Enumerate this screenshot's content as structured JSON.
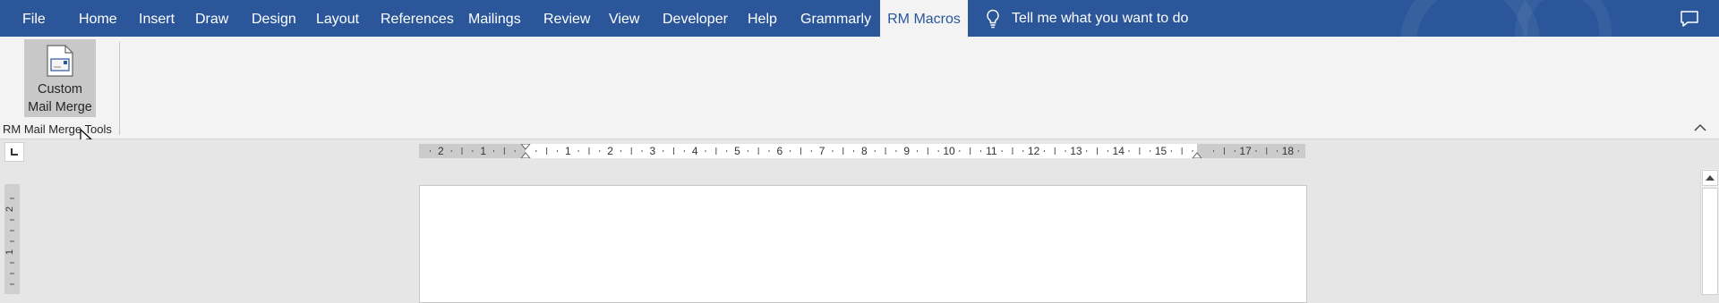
{
  "tabs": [
    {
      "label": "File"
    },
    {
      "label": "Home"
    },
    {
      "label": "Insert"
    },
    {
      "label": "Draw"
    },
    {
      "label": "Design"
    },
    {
      "label": "Layout"
    },
    {
      "label": "References"
    },
    {
      "label": "Mailings"
    },
    {
      "label": "Review"
    },
    {
      "label": "View"
    },
    {
      "label": "Developer"
    },
    {
      "label": "Help"
    },
    {
      "label": "Grammarly"
    },
    {
      "label": "RM Macros",
      "active": true
    }
  ],
  "tell_me": {
    "text": "Tell me what you want to do",
    "icon": "lightbulb-icon"
  },
  "ribbon": {
    "button": {
      "line1": "Custom",
      "line2": "Mail Merge",
      "icon": "document-icon"
    },
    "group_label": "RM Mail Merge Tools"
  },
  "horizontal_ruler": {
    "left_numbers": [
      "2",
      "1"
    ],
    "right_numbers": [
      "1",
      "2",
      "3",
      "4",
      "5",
      "6",
      "7",
      "8",
      "9",
      "10",
      "11",
      "12",
      "13",
      "14",
      "15",
      "17",
      "18"
    ]
  },
  "vertical_ruler": {
    "numbers": [
      "2",
      "1"
    ]
  },
  "colors": {
    "accent": "#2b579a",
    "ribbon_bg": "#f3f3f3",
    "pressed_button": "#c8c8c8"
  }
}
